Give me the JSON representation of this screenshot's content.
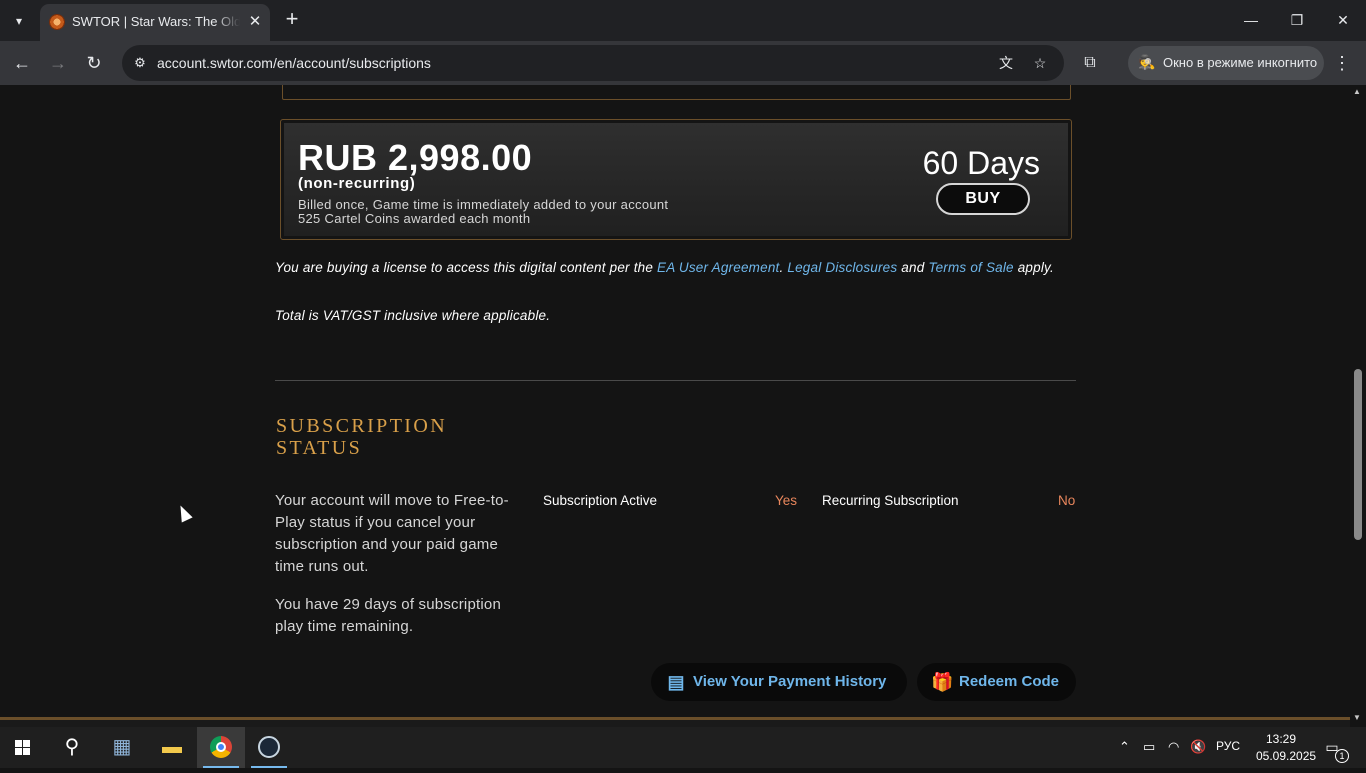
{
  "browser": {
    "tab_search_icon": "chevron-down-icon",
    "tab": {
      "title": "SWTOR | Star Wars: The Old Republic",
      "close_glyph": "✕"
    },
    "new_tab_glyph": "+",
    "window_controls": {
      "minimize": "—",
      "restore": "❐",
      "close": "✕"
    },
    "nav": {
      "back": "←",
      "forward": "→",
      "reload": "↻"
    },
    "url": "account.swtor.com/en/account/subscriptions",
    "site_info_glyph": "⚙",
    "translate_glyph": "文",
    "bookmark_glyph": "☆",
    "extensions_glyph": "⧉",
    "incognito": {
      "icon": "🕵",
      "label": "Окно в режиме инкогнито"
    },
    "menu_glyph": "⋮"
  },
  "offer": {
    "price": "RUB 2,998.00",
    "type": "(non-recurring)",
    "billed": "Billed once, Game time is immediately added to your account",
    "coins": "525 Cartel Coins awarded each month",
    "duration": "60 Days",
    "buy_label": "BUY"
  },
  "legal": {
    "prefix": "You are buying a license to access this digital content per the ",
    "link_agreement": "EA User Agreement",
    "sep1": ". ",
    "link_disclosures": "Legal Disclosures",
    "and": " and ",
    "link_terms": "Terms of Sale",
    "suffix": " apply.",
    "vat": "Total is VAT/GST inclusive where applicable."
  },
  "subscription_status": {
    "title": "SUBSCRIPTION STATUS",
    "description": "Your account will move to Free-to-Play status if you cancel your subscription and your paid game time runs out.",
    "remaining": "You have 29 days of subscription play time remaining.",
    "active_label": "Subscription Active",
    "active_value": "Yes",
    "recurring_label": "Recurring Subscription",
    "recurring_value": "No"
  },
  "actions": {
    "payment_history": "View Your Payment History",
    "redeem_code": "Redeem Code"
  },
  "taskbar": {
    "language": "РУС",
    "time": "13:29",
    "date": "05.09.2025",
    "notification_count": "1"
  }
}
